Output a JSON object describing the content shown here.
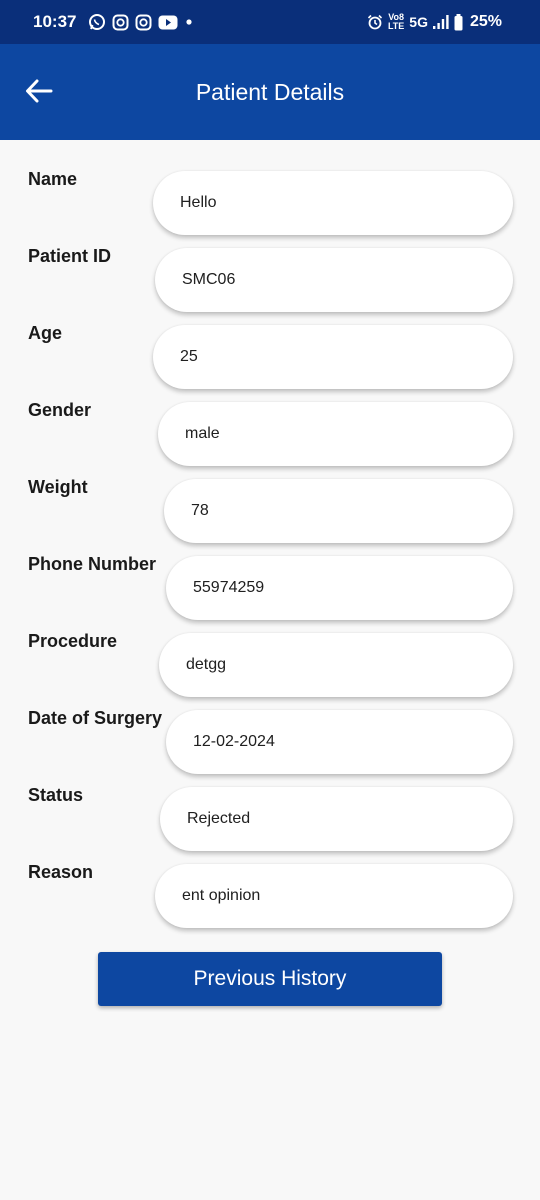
{
  "status_bar": {
    "time": "10:37",
    "network_tag_top": "Vo8",
    "network_tag_bottom": "LTE",
    "network": "5G",
    "battery": "25%"
  },
  "app_bar": {
    "title": "Patient Details"
  },
  "fields": [
    {
      "label": "Name",
      "value": "Hello"
    },
    {
      "label": "Patient ID",
      "value": "SMC06"
    },
    {
      "label": "Age",
      "value": "25"
    },
    {
      "label": "Gender",
      "value": "male"
    },
    {
      "label": "Weight",
      "value": "78"
    },
    {
      "label": "Phone Number",
      "value": "55974259"
    },
    {
      "label": "Procedure",
      "value": "detgg"
    },
    {
      "label": "Date of Surgery",
      "value": "12-02-2024"
    },
    {
      "label": "Status",
      "value": "Rejected"
    },
    {
      "label": "Reason",
      "value": "ent opinion"
    }
  ],
  "actions": {
    "history_label": "Previous History"
  },
  "colors": {
    "status_bar": "#0a2f7a",
    "app_bar": "#0d47a1",
    "background": "#f8f8f8"
  }
}
